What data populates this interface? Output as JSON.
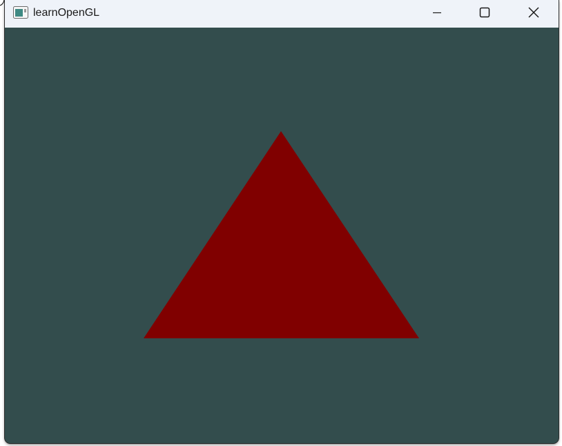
{
  "window": {
    "title": "learnOpenGL",
    "app_icon": "opengl-app-icon",
    "controls": {
      "minimize_icon": "minimize-icon",
      "maximize_icon": "maximize-icon",
      "close_icon": "close-icon"
    }
  },
  "scene": {
    "clear_color": "#334d4d",
    "triangle": {
      "fill": "#800000",
      "shape": "triangle"
    }
  },
  "colors": {
    "titlebar": "#eff3f9",
    "title_text": "#1a1a1a"
  }
}
